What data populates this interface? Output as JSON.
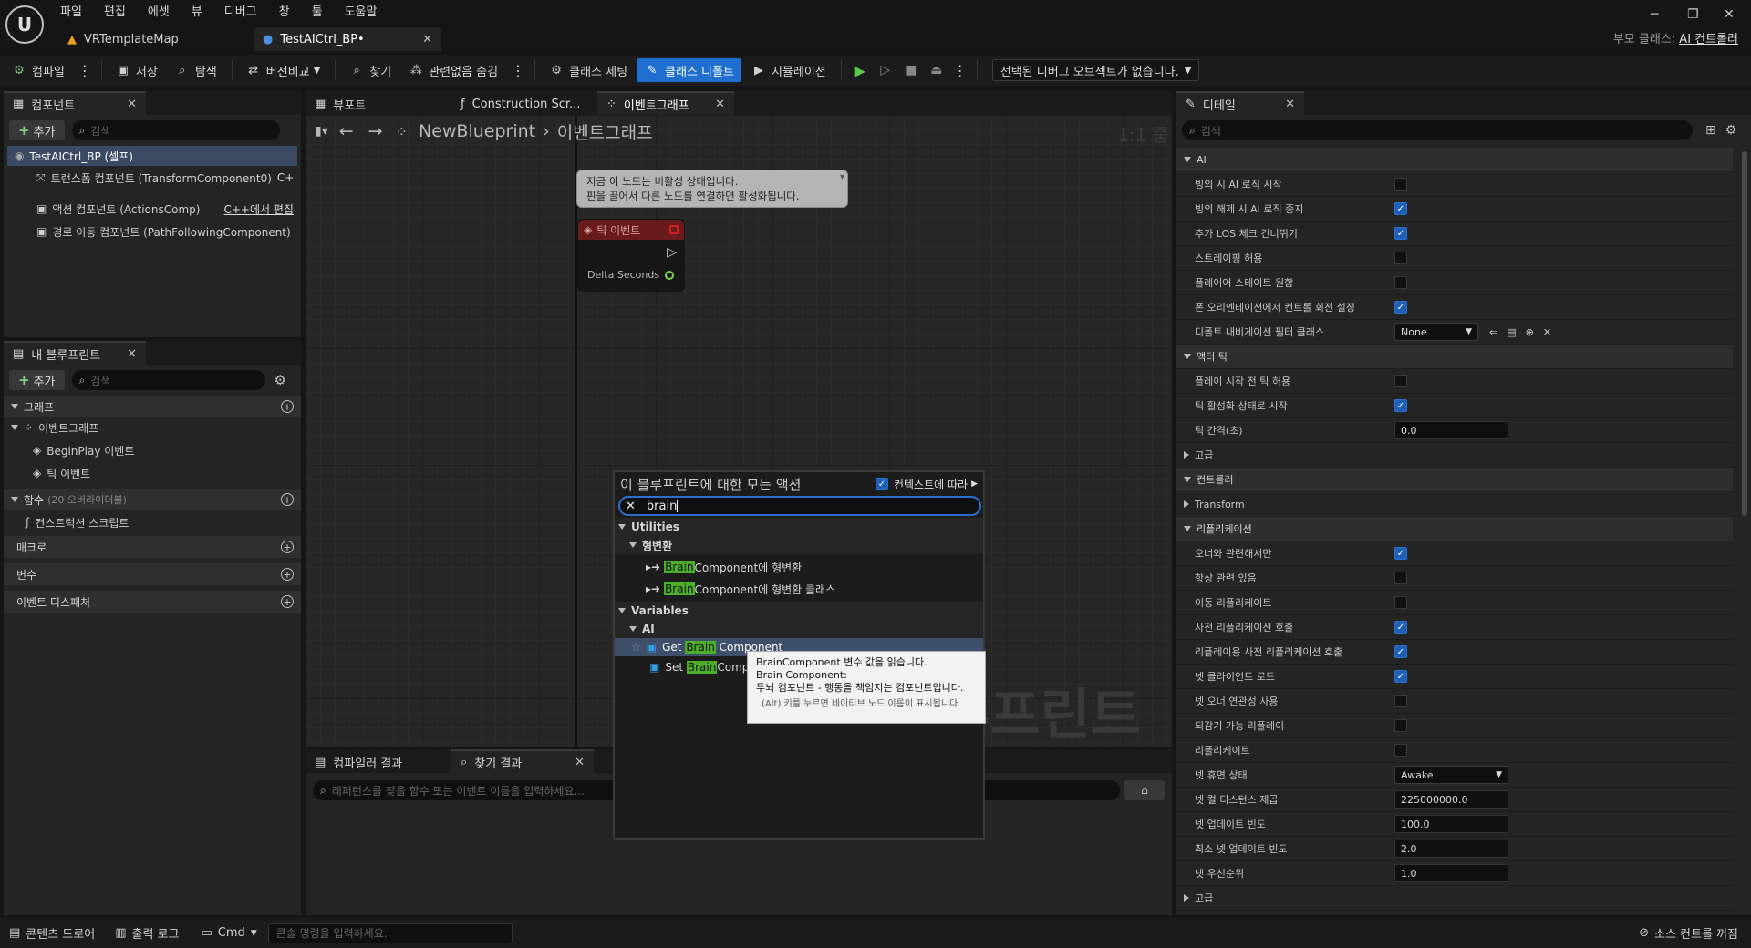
{
  "menu": [
    "파일",
    "편집",
    "에셋",
    "뷰",
    "디버그",
    "창",
    "툴",
    "도움말"
  ],
  "doc_tabs": [
    {
      "label": "VRTemplateMap"
    },
    {
      "label": "TestAICtrl_BP•"
    }
  ],
  "parent_class": {
    "prefix": "부모 클래스:",
    "value": "AI 컨트롤러"
  },
  "toolbar": {
    "compile": "컴파일",
    "save": "저장",
    "browse": "탐색",
    "diff": "버전비교",
    "find": "찾기",
    "hide_unrelated": "관련없음 숨김",
    "class_settings": "클래스 세팅",
    "class_defaults": "클래스 디폴트",
    "simulation": "시뮬레이션",
    "debug_object": "선택된 디버그 오브젝트가 없습니다."
  },
  "components": {
    "tab": "컴포넌트",
    "add": "추가",
    "search_placeholder": "검색",
    "root": "TestAICtrl_BP (셀프)",
    "items": [
      {
        "label": "트랜스폼 컴포넌트 (TransformComponent0)",
        "extra": "C+"
      },
      {
        "label": "액션 컴포넌트 (ActionsComp)",
        "extra": "C++에서 편집"
      },
      {
        "label": "경로 이동 컴포넌트 (PathFollowingComponent)",
        "extra": ""
      }
    ]
  },
  "my_blueprint": {
    "tab": "내 블루프린트",
    "add": "추가",
    "search_placeholder": "검색",
    "graphs_header": "그래프",
    "event_graph": "이벤트그래프",
    "events": [
      "BeginPlay 이벤트",
      "틱 이벤트"
    ],
    "functions_header": "함수",
    "functions_override": "(20 오버라이더블)",
    "construction_script": "컨스트럭션 스크립트",
    "macros": "매크로",
    "variables": "변수",
    "dispatchers": "이벤트 디스패처"
  },
  "graph_tabs": [
    "뷰포트",
    "Construction Scr...",
    "이벤트그래프"
  ],
  "breadcrumb": {
    "bp": "NewBlueprint",
    "graph": "이벤트그래프",
    "zoom": "1:1 줌",
    "watermark": "블루프린트"
  },
  "tick_node": {
    "comment_line1": "지금 이 노드는 비활성 상태입니다.",
    "comment_line2": "핀을 끌어서 다른 노드를 연결하면 활성화됩니다.",
    "title": "틱 이벤트",
    "pin": "Delta Seconds"
  },
  "action_menu": {
    "title": "이 블루프린트에 대한 모든 액션",
    "context_label": "컨텍스트에 따라",
    "search_value": "brain",
    "cat_utilities": "Utilities",
    "cat_cast": "형변환",
    "cast1_hl": "Brain",
    "cast1_rest": "Component에 형변환",
    "cast2_hl": "Brain",
    "cast2_rest": "Component에 형변환 클래스",
    "cat_variables": "Variables",
    "cat_ai": "AI",
    "get_pre": "Get ",
    "get_hl": "Brain",
    "get_post": " Component",
    "set_pre": "Set ",
    "set_hl": "Brain",
    "set_post": " Comp"
  },
  "tooltip": {
    "line1": "BrainComponent 변수 값을 읽습니다.",
    "line2": "Brain Component:",
    "line3": "두뇌 컴포넌트 - 행동을 책임지는 컴포넌트입니다.",
    "line4": "(Alt) 키를 누르면 네이티브 노드 이름이 표시됩니다."
  },
  "bottom_tabs": {
    "compiler": "컴파일러 결과",
    "find": "찾기 결과",
    "find_placeholder": "레퍼런스를 찾을 함수 또는 이벤트 이름을 입력하세요..."
  },
  "details": {
    "tab": "디테일",
    "search_placeholder": "검색",
    "sec_ai": "AI",
    "ai_rows": [
      {
        "label": "빙의 시 AI 로직 시작",
        "checked": false
      },
      {
        "label": "빙의 해제 시 AI 로직 중지",
        "checked": true
      },
      {
        "label": "추가 LOS 체크 건너뛰기",
        "checked": true
      },
      {
        "label": "스트레이핑 허용",
        "checked": false
      },
      {
        "label": "플레이어 스테이트 원함",
        "checked": false
      },
      {
        "label": "폰 오리엔테이션에서 컨트롤 회전 설정",
        "checked": true
      }
    ],
    "nav_filter_label": "디폴트 내비게이션 필터 클래스",
    "nav_filter_value": "None",
    "sec_actor_tick": "액터 틱",
    "tick_rows": [
      {
        "label": "플레이 시작 전 틱 허용",
        "checked": false
      },
      {
        "label": "틱 활성화 상태로 시작",
        "checked": true
      }
    ],
    "tick_interval_label": "틱 간격(초)",
    "tick_interval_value": "0.0",
    "advanced": "고급",
    "sec_controller": "컨트롤러",
    "transform": "Transform",
    "sec_replication": "리플리케이션",
    "rep_rows": [
      {
        "label": "오너와 관련해서만",
        "checked": true
      },
      {
        "label": "항상 관련 있음",
        "checked": false
      },
      {
        "label": "이동 리플리케이트",
        "checked": false
      },
      {
        "label": "사전 리플리케이션 호출",
        "checked": true
      },
      {
        "label": "리플레이용 사전 리플리케이션 호출",
        "checked": true
      },
      {
        "label": "넷 클라이언트 로드",
        "checked": true
      },
      {
        "label": "넷 오너 연관성 사용",
        "checked": false
      },
      {
        "label": "되감기 가능 리플레이",
        "checked": false
      },
      {
        "label": "리플리케이트",
        "checked": false
      }
    ],
    "dormancy_label": "넷 휴면 상태",
    "dormancy_value": "Awake",
    "cull_label": "넷 컬 디스턴스 제곱",
    "cull_value": "225000000.0",
    "update_label": "넷 업데이트 빈도",
    "update_value": "100.0",
    "min_update_label": "최소 넷 업데이트 빈도",
    "min_update_value": "2.0",
    "priority_label": "넷 우선순위",
    "priority_value": "1.0",
    "advanced2": "고급"
  },
  "statusbar": {
    "content_drawer": "콘텐츠 드로어",
    "output_log": "출력 로그",
    "cmd": "Cmd",
    "console_placeholder": "콘솔 명령을 입력하세요.",
    "source_control": "소스 컨트롤 꺼짐"
  },
  "colors": {
    "accent": "#1e6fd0",
    "highlight": "#4caf2a",
    "panel": "#242424",
    "background": "#151515"
  }
}
